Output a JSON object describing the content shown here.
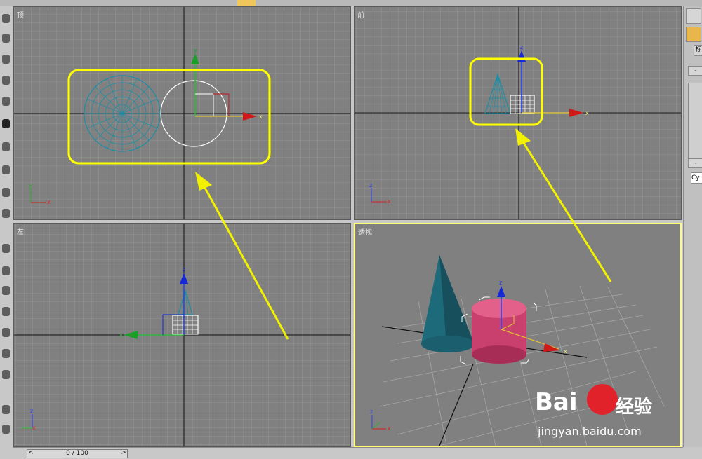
{
  "viewports": {
    "top": {
      "label": "顶"
    },
    "front": {
      "label": "前"
    },
    "left": {
      "label": "左"
    },
    "perspective": {
      "label": "透视"
    }
  },
  "axes": {
    "x": "x",
    "y": "y",
    "z": "z"
  },
  "right_panel": {
    "tab_label": "标",
    "name_field": "Cy",
    "minus1": "-",
    "minus2": "-"
  },
  "timeline": {
    "frame": "0 / 100",
    "prev": "<",
    "next": ">"
  },
  "watermark": {
    "brand": "Bai",
    "brand_suffix": "经验",
    "url": "jingyan.baidu.com"
  },
  "colors": {
    "highlight": "#ffff00",
    "viewport_bg": "#808080",
    "active_border": "#ffff70",
    "cone": "#1c6a7a",
    "cylinder": "#c9406e"
  }
}
